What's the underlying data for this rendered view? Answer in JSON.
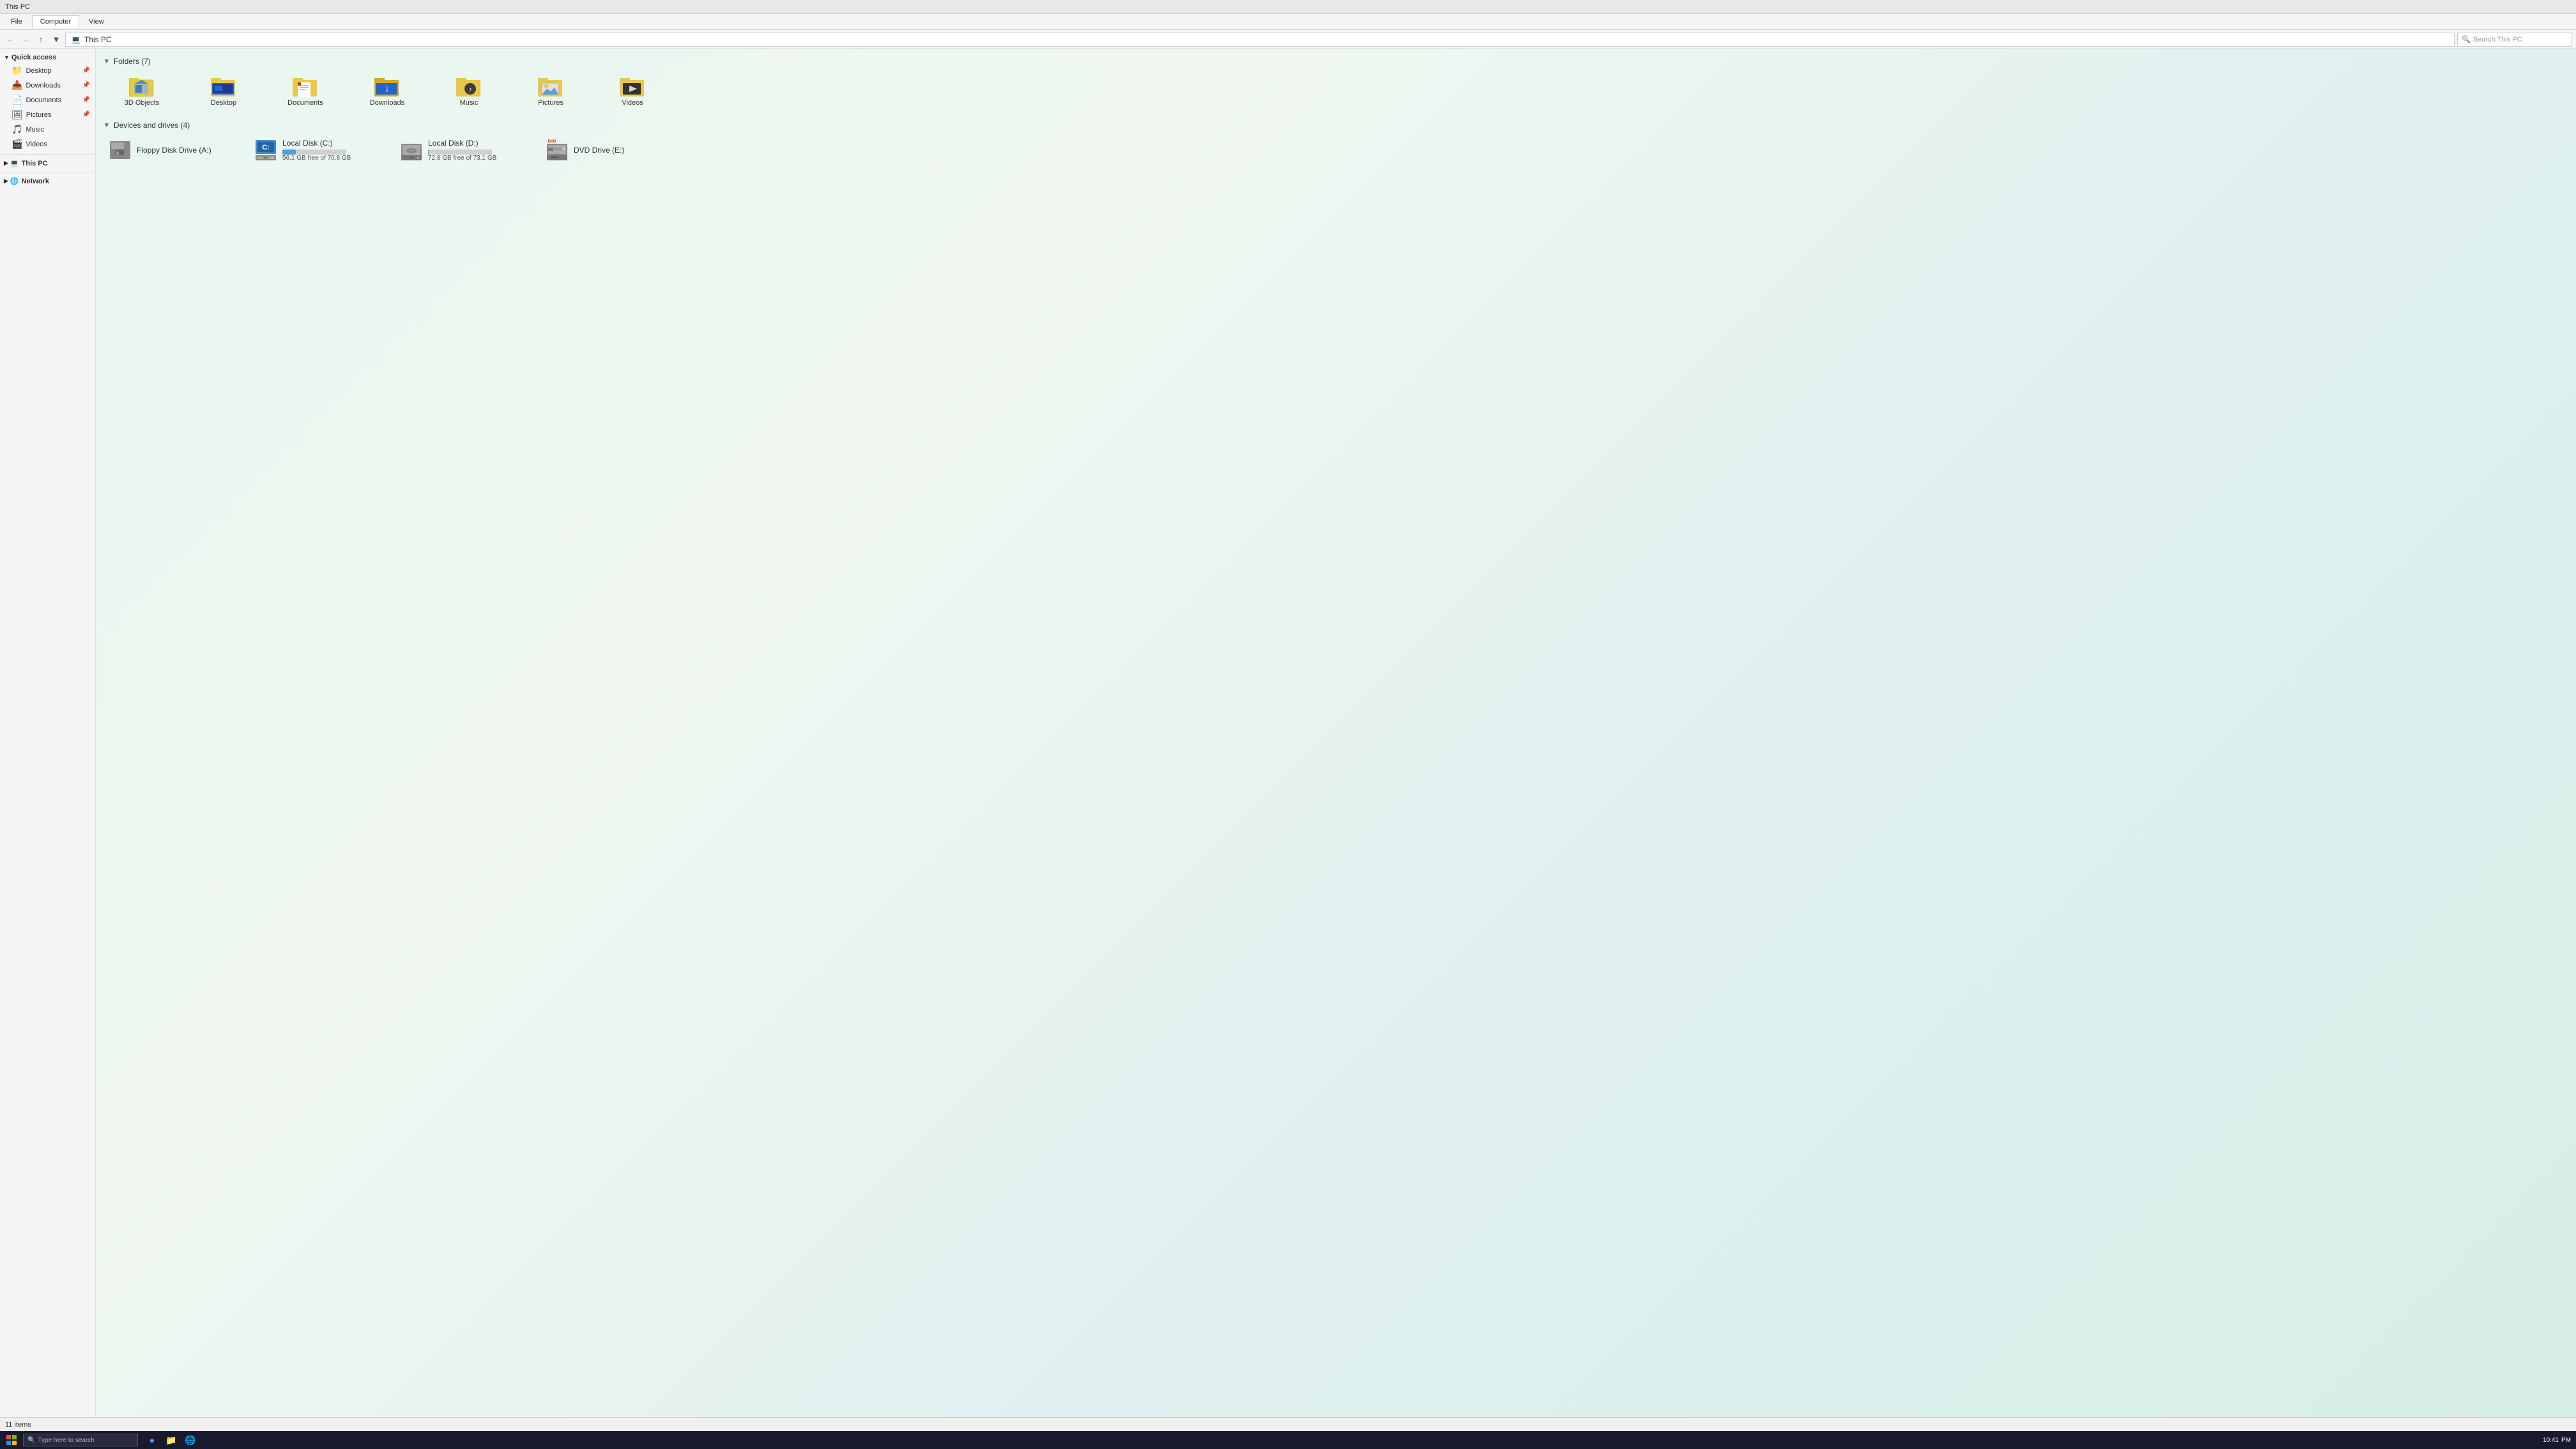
{
  "titlebar": {
    "title": "This PC"
  },
  "ribbon": {
    "tabs": [
      {
        "id": "file",
        "label": "File"
      },
      {
        "id": "computer",
        "label": "Computer"
      },
      {
        "id": "view",
        "label": "View"
      }
    ],
    "active_tab": "computer"
  },
  "addressbar": {
    "path": "This PC",
    "search_placeholder": "Search This PC"
  },
  "sidebar": {
    "quick_access_label": "Quick access",
    "items_quick": [
      {
        "id": "desktop",
        "label": "Desktop",
        "pinned": true,
        "icon": "📁"
      },
      {
        "id": "downloads",
        "label": "Downloads",
        "pinned": true,
        "icon": "📥"
      },
      {
        "id": "documents",
        "label": "Documents",
        "pinned": true,
        "icon": "📄"
      },
      {
        "id": "pictures",
        "label": "Pictures",
        "pinned": true,
        "icon": "🖼"
      },
      {
        "id": "music",
        "label": "Music",
        "icon": "🎵"
      },
      {
        "id": "videos",
        "label": "Videos",
        "icon": "🎬"
      }
    ],
    "this_pc_label": "This PC",
    "network_label": "Network"
  },
  "content": {
    "folders_section": "Folders (7)",
    "folders": [
      {
        "id": "3dobjects",
        "label": "3D Objects",
        "icon": "3d"
      },
      {
        "id": "desktop",
        "label": "Desktop",
        "icon": "desktop"
      },
      {
        "id": "documents",
        "label": "Documents",
        "icon": "documents"
      },
      {
        "id": "downloads",
        "label": "Downloads",
        "icon": "downloads"
      },
      {
        "id": "music",
        "label": "Music",
        "icon": "music"
      },
      {
        "id": "pictures",
        "label": "Pictures",
        "icon": "pictures"
      },
      {
        "id": "videos",
        "label": "Videos",
        "icon": "videos"
      }
    ],
    "devices_section": "Devices and drives (4)",
    "drives": [
      {
        "id": "floppy",
        "label": "Floppy Disk Drive (A:)",
        "space_free": "",
        "space_total": "",
        "fill_pct": 0,
        "icon": "floppy"
      },
      {
        "id": "localc",
        "label": "Local Disk (C:)",
        "space_free": "56.1 GB free of 70.8 GB",
        "fill_pct": 21,
        "icon": "hdd"
      },
      {
        "id": "locald",
        "label": "Local Disk (D:)",
        "space_free": "72.8 GB free of 73.1 GB",
        "fill_pct": 0,
        "icon": "hdd"
      },
      {
        "id": "dvde",
        "label": "DVD Drive (E:)",
        "space_free": "",
        "fill_pct": 0,
        "icon": "dvd"
      }
    ]
  },
  "statusbar": {
    "item_count": "11 items"
  },
  "taskbar": {
    "search_placeholder": "Type here to search",
    "time": "10:41",
    "date": "PM"
  }
}
